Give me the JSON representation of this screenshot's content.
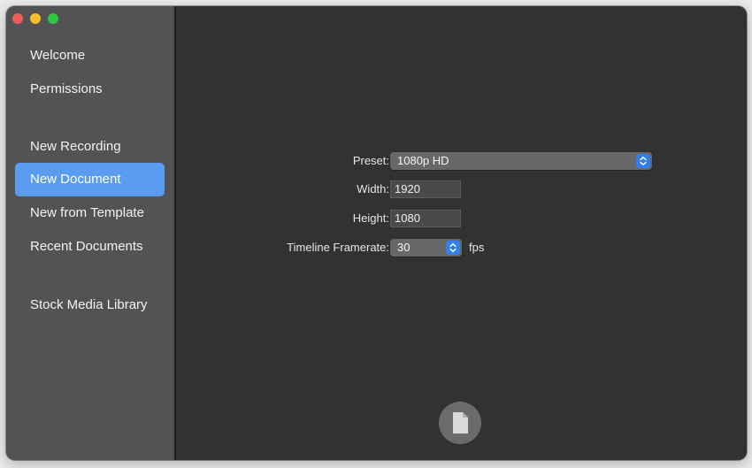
{
  "sidebar": {
    "items": [
      {
        "label": "Welcome"
      },
      {
        "label": "Permissions"
      },
      {
        "label": "New Recording"
      },
      {
        "label": "New Document",
        "selected": true
      },
      {
        "label": "New from Template"
      },
      {
        "label": "Recent Documents"
      },
      {
        "label": "Stock Media Library"
      }
    ]
  },
  "form": {
    "preset_label": "Preset:",
    "preset_value": "1080p HD",
    "width_label": "Width:",
    "width_value": "1920",
    "height_label": "Height:",
    "height_value": "1080",
    "framerate_label": "Timeline Framerate:",
    "framerate_value": "30",
    "framerate_units": "fps"
  },
  "icons": {
    "create_document": "document-icon",
    "stepper": "chevron-up-down-icon"
  },
  "colors": {
    "accent": "#5a9cf0",
    "stepper": "#2f7ff0",
    "sidebar_bg": "#535254",
    "content_bg": "#333232"
  }
}
